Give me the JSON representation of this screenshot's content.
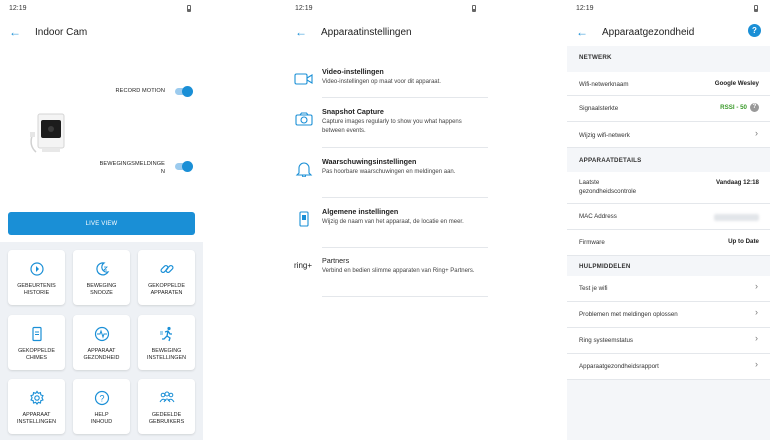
{
  "status": {
    "time": "12:19"
  },
  "screen1": {
    "title": "Indoor Cam",
    "toggles": [
      {
        "label": "RECORD MOTION",
        "on": true
      },
      {
        "label": "BEWEGINGSMELDINGE",
        "label2": "N",
        "on": true
      }
    ],
    "live_view": "LIVE VIEW",
    "tiles": [
      {
        "l1": "GEBEURTENIS",
        "l2": "HISTORIE",
        "icon": "history-icon"
      },
      {
        "l1": "BEWEGING",
        "l2": "SNOOZE",
        "icon": "snooze-moon-icon"
      },
      {
        "l1": "GEKOPPELDE",
        "l2": "APPARATEN",
        "icon": "link-icon"
      },
      {
        "l1": "GEKOPPELDE",
        "l2": "CHIMES",
        "icon": "chime-icon"
      },
      {
        "l1": "APPARAAT",
        "l2": "GEZONDHEID",
        "icon": "health-pulse-icon"
      },
      {
        "l1": "BEWEGING",
        "l2": "INSTELLINGEN",
        "icon": "running-person-icon"
      },
      {
        "l1": "APPARAAT",
        "l2": "INSTELLINGEN",
        "icon": "gear-icon"
      },
      {
        "l1": "HELP",
        "l2": "INHOUD",
        "icon": "help-icon"
      },
      {
        "l1": "GEDEELDE",
        "l2": "GEBRUIKERS",
        "icon": "users-icon"
      }
    ]
  },
  "screen2": {
    "title": "Apparaatinstellingen",
    "items": [
      {
        "title": "Video-instellingen",
        "desc": "Video-instellingen op maat voor dit apparaat.",
        "icon": "video-camera-icon"
      },
      {
        "title": "Snapshot Capture",
        "desc": "Capture images regularly to show you what happens between events.",
        "icon": "camera-icon"
      },
      {
        "title": "Waarschuwingsinstellingen",
        "desc": "Pas hoorbare waarschuwingen en meldingen aan.",
        "icon": "bell-icon"
      },
      {
        "title": "Algemene instellingen",
        "desc": "Wijzig de naam van het apparaat, de locatie en meer.",
        "icon": "device-icon"
      },
      {
        "title": "Partners",
        "desc": "Verbind en bedien slimme apparaten van Ring+ Partners.",
        "icon": "ring-logo",
        "logo_text": "ring+"
      }
    ]
  },
  "screen3": {
    "title": "Apparaatgezondheid",
    "help_glyph": "?",
    "sections": {
      "netwerk": "NETWERK",
      "details": "APPARAATDETAILS",
      "hulp": "HULPMIDDELEN"
    },
    "network": {
      "wifi_label": "Wifi-netwerknaam",
      "wifi_value": "Google Wesley",
      "signal_label": "Signaalsterkte",
      "signal_value": "RSSI - 50",
      "change_wifi": "Wijzig wifi-netwerk"
    },
    "details": {
      "check_l1": "Laatste",
      "check_l2": "gezondheidscontrole",
      "check_value": "Vandaag 12:18",
      "mac_label": "MAC Address",
      "firmware_label": "Firmware",
      "firmware_value": "Up to Date"
    },
    "tools": [
      "Test je wifi",
      "Problemen met meldingen oplossen",
      "Ring systeemstatus",
      "Apparaatgezondheidsrapport"
    ]
  }
}
